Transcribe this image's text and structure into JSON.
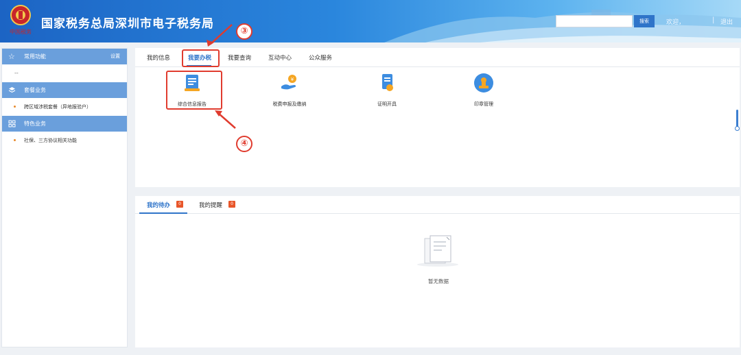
{
  "header": {
    "title": "国家税务总局深圳市电子税务局",
    "logo_text": "中国税务",
    "search_placeholder": "",
    "search_button": "搜索",
    "welcome": "欢迎，",
    "separator": "|",
    "logout": "退出"
  },
  "sidebar": {
    "common": {
      "label": "常用功能",
      "settings": "设置",
      "placeholder": "--"
    },
    "package": {
      "label": "套餐业务",
      "items": [
        "跨区域涉税套餐（异地报验户）"
      ]
    },
    "special": {
      "label": "特色业务",
      "items": [
        "社保、三方协议相关功能"
      ]
    }
  },
  "tabs": [
    "我的信息",
    "我要办税",
    "我要查询",
    "互动中心",
    "公众服务"
  ],
  "active_tab": "我要办税",
  "functions": [
    {
      "label": "综合信息报告",
      "icon": "report-document-icon"
    },
    {
      "label": "税费申报及缴纳",
      "icon": "tax-payment-hand-icon"
    },
    {
      "label": "证明开具",
      "icon": "certificate-icon"
    },
    {
      "label": "印章管理",
      "icon": "seal-stamp-icon"
    }
  ],
  "bottom_tabs": [
    {
      "label": "我的待办",
      "count": "0"
    },
    {
      "label": "我的提醒",
      "count": "0"
    }
  ],
  "empty_text": "暂无数据",
  "annotations": {
    "step3": "③",
    "step4": "④"
  },
  "colors": {
    "accent": "#2f74c9",
    "highlight": "#e03b2e",
    "sidebar_header": "#6a9fdc",
    "badge": "#e8562a"
  }
}
